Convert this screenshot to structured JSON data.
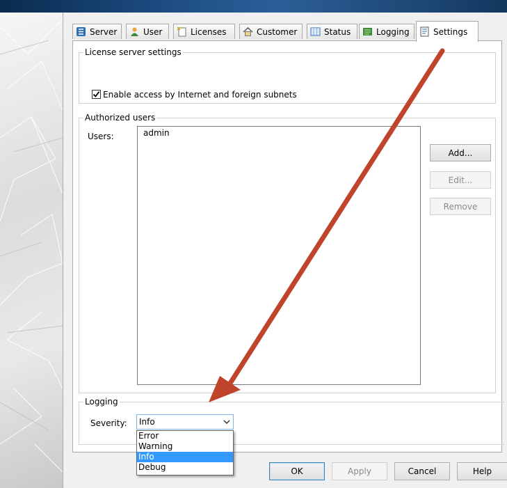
{
  "tabs": [
    {
      "label": "Server",
      "icon": "server-icon"
    },
    {
      "label": "User",
      "icon": "user-icon"
    },
    {
      "label": "Licenses",
      "icon": "licenses-icon"
    },
    {
      "label": "Customer",
      "icon": "customer-icon"
    },
    {
      "label": "Status",
      "icon": "status-icon"
    },
    {
      "label": "Logging",
      "icon": "logging-icon"
    },
    {
      "label": "Settings",
      "icon": "settings-icon",
      "active": true
    }
  ],
  "license_settings": {
    "legend": "License server settings",
    "checkbox_label": "Enable access by Internet and foreign subnets",
    "checked": true
  },
  "authorized_users": {
    "legend": "Authorized users",
    "users_label": "Users:",
    "users": [
      "admin"
    ],
    "add_label": "Add...",
    "edit_label": "Edit...",
    "remove_label": "Remove"
  },
  "logging": {
    "legend": "Logging",
    "severity_label": "Severity:",
    "severity_value": "Info",
    "options": [
      "Error",
      "Warning",
      "Info",
      "Debug"
    ],
    "selected_option": "Info"
  },
  "footer": {
    "ok_label": "OK",
    "apply_label": "Apply",
    "cancel_label": "Cancel",
    "help_label": "Help"
  },
  "colors": {
    "accent_selection": "#3399ff",
    "annotation_arrow": "#c0432c"
  }
}
